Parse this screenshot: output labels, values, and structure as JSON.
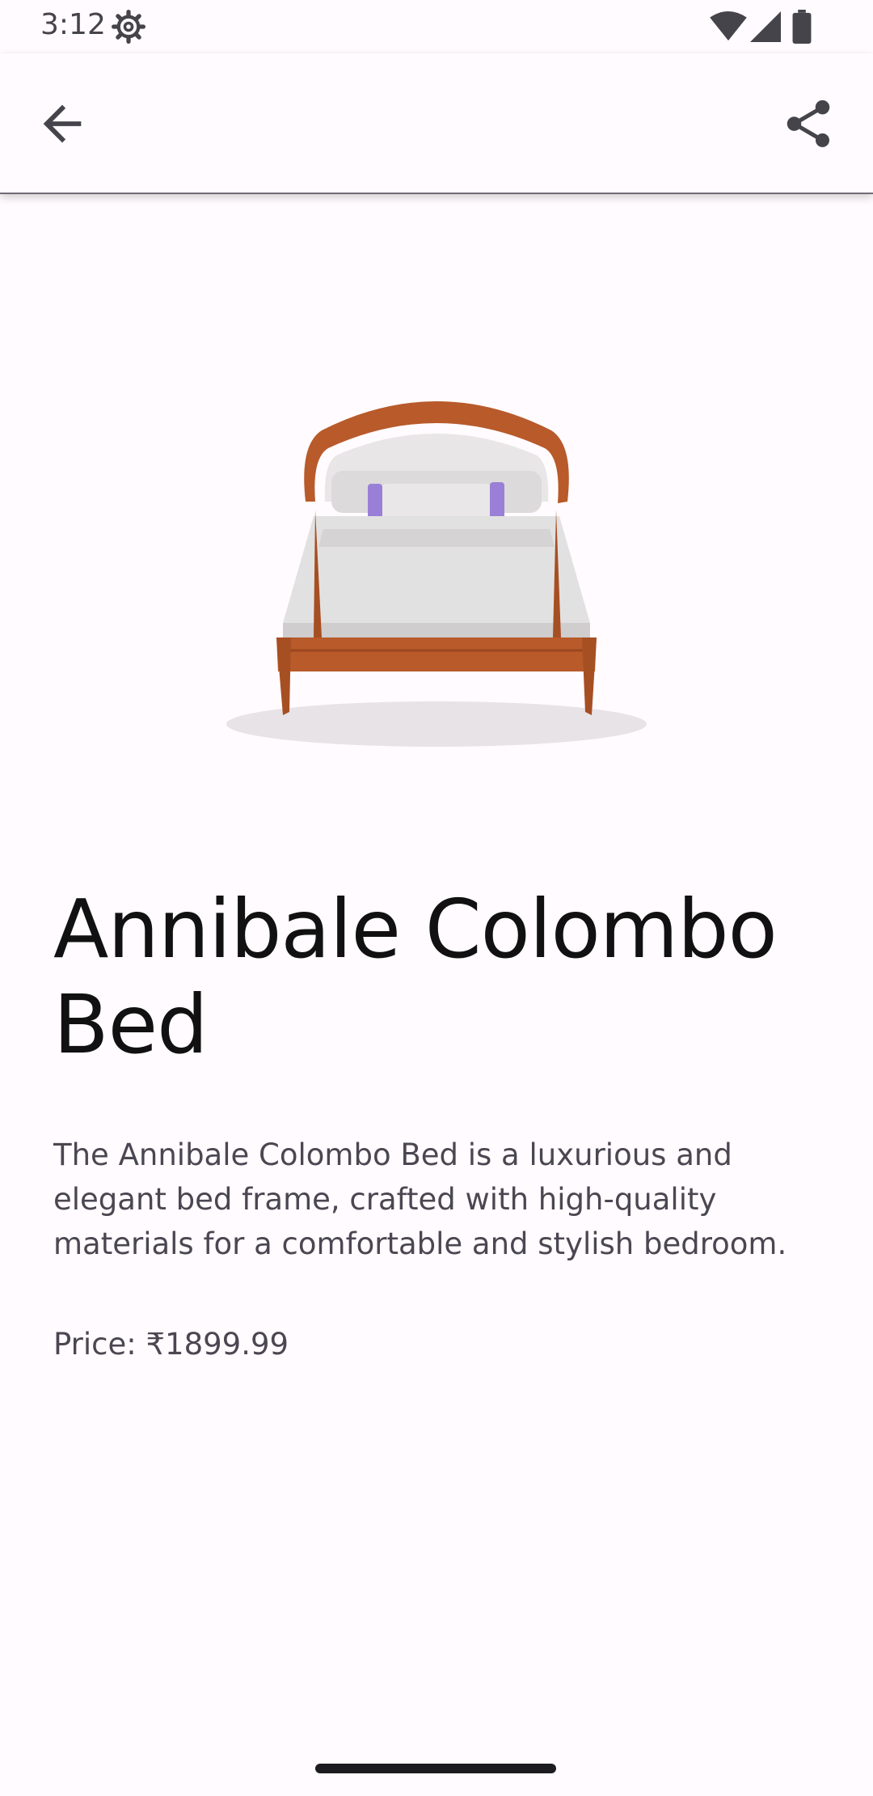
{
  "status_bar": {
    "time": "3:12",
    "icons": [
      "gear-icon",
      "wifi-icon",
      "cell-signal-icon",
      "battery-icon"
    ]
  },
  "app_bar": {
    "back_icon": "arrow-back-icon",
    "share_icon": "share-icon"
  },
  "product": {
    "image_subject": "bed-image",
    "title": "Annibale Colombo Bed",
    "description": "The Annibale Colombo Bed is a luxurious and elegant bed frame, crafted with high-quality materials for a comfortable and stylish bedroom.",
    "price": "Price: ₹1899.99"
  },
  "colors": {
    "background": "#fffbfe",
    "text_primary": "#111111",
    "text_secondary": "#4a4752",
    "wood": "#b85a2a",
    "pillow_accent": "#9a7fd6"
  }
}
